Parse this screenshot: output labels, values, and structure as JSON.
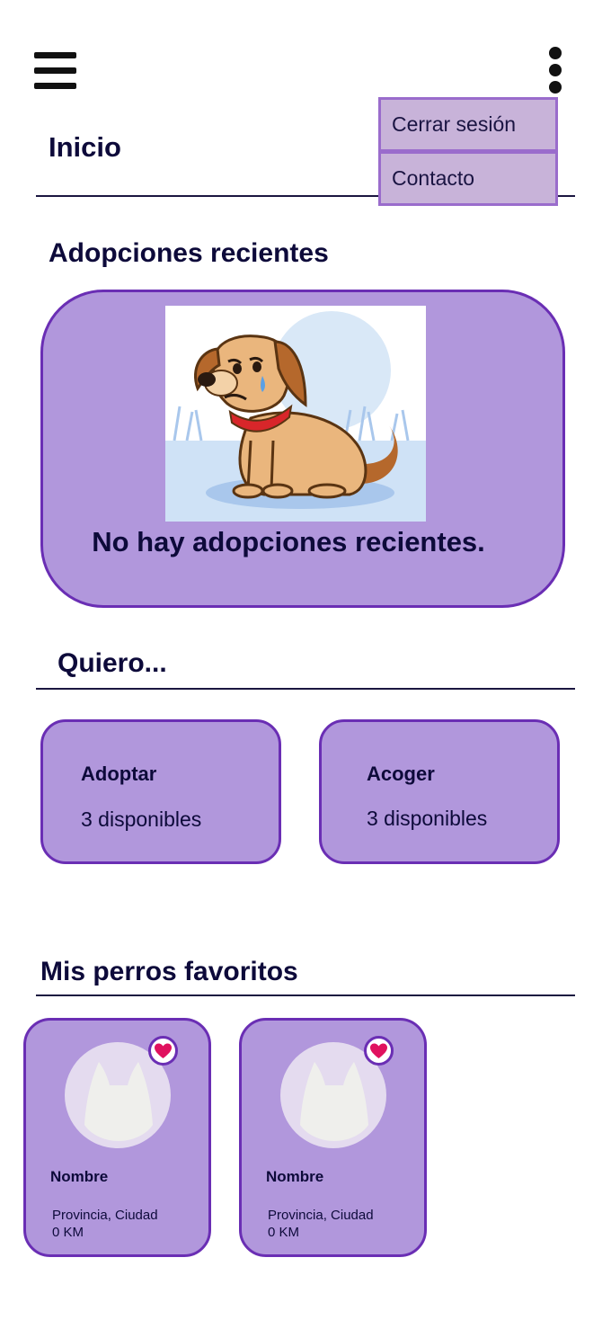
{
  "header": {
    "menu_icon": "hamburger-icon",
    "more_icon": "vertical-dots-icon"
  },
  "dropdown": {
    "items": [
      {
        "label": "Cerrar sesión"
      },
      {
        "label": "Contacto"
      }
    ]
  },
  "page_title": "Inicio",
  "recent": {
    "title": "Adopciones recientes",
    "empty_message": "No hay adopciones recientes.",
    "image": "sad-dog-illustration"
  },
  "want": {
    "title": "Quiero...",
    "options": [
      {
        "label": "Adoptar",
        "count": "3 disponibles"
      },
      {
        "label": "Acoger",
        "count": "3 disponibles"
      }
    ]
  },
  "favorites": {
    "title": "Mis perros favoritos",
    "items": [
      {
        "name": "Nombre",
        "location": "Provincia, Ciudad",
        "distance": "0 KM"
      },
      {
        "name": "Nombre",
        "location": "Provincia, Ciudad",
        "distance": "0 KM"
      }
    ]
  },
  "colors": {
    "card_fill": "#b197dc",
    "card_border": "#6a2eb4",
    "menu_fill": "#c8b3d9",
    "heart": "#e0115f",
    "text_dark": "#0d0a3a"
  }
}
